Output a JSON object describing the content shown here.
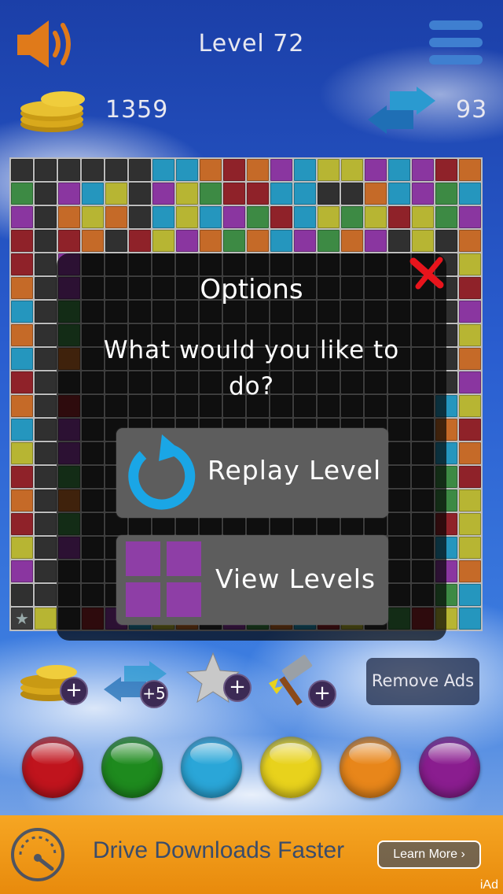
{
  "header": {
    "level_title": "Level 72",
    "coins": "1359",
    "swaps": "93"
  },
  "icons": {
    "speaker": "speaker-icon",
    "menu": "hamburger-menu-icon",
    "coins": "coin-stack-icon",
    "swap": "swap-arrows-icon"
  },
  "board": {
    "colors": {
      "K": "#303030",
      "R": "#8f2229",
      "G": "#3d8a44",
      "B": "#2596be",
      "Y": "#b7b533",
      "O": "#c56a28",
      "P": "#8a36a0",
      "S": "#3c3c3c"
    },
    "rows": [
      "KKKKKKBBOROPBYYPBPRO",
      "GKPBYKPYGRRBBKKOBPGB",
      "PKOYOKBYBPGRBYGYRYGP",
      "RKROKRYPOGOBPGOPKYKO",
      "RKPKKKKKKKKKKKKKKKKY",
      "OKPKKKKKKKKKKKKKKKKR",
      "BKGKKKKKKKKKKKKKKKKP",
      "OKGKKKKKKKKKKKKKKKKY",
      "BKOKKKKKKKKKKKKKKKKO",
      "RKKKKKKKKKKKKKKKKKKP",
      "OKRKKKKKKKKKKKKKKKBY",
      "BKPKKKKKKKKKKKKKKKOR",
      "YKPKKKKKKKKKKKKKKKBO",
      "RKGKKKKKKKKKKKKKKKGR",
      "OKOKKKKKKKKKKKKKKKGY",
      "RKGKKKKKKKKKKKKKKKRY",
      "YKPKKKKKKKKKKKKKKKBY",
      "PKKKKKKKKKKKKKKKKKPO",
      "KKKKKKKKKKKKKKKKKKGB",
      "SYKRPBYOKPGOBRYKGRYB"
    ]
  },
  "modal": {
    "title": "Options",
    "question": "What would you like to do?",
    "replay_label": "Replay Level",
    "levels_label": "View Levels",
    "close_icon": "close-x-icon",
    "replay_icon": "replay-arrow-icon",
    "levels_icon": "level-grid-icon"
  },
  "powerups": {
    "coins_plus": "+",
    "swaps_plus": "+5",
    "star_plus": "+",
    "hammer_plus": "+",
    "remove_ads": "Remove Ads"
  },
  "balls": [
    {
      "name": "red-ball",
      "color": "#c0141d"
    },
    {
      "name": "green-ball",
      "color": "#1e8a1e"
    },
    {
      "name": "blue-ball",
      "color": "#2aa6d8"
    },
    {
      "name": "yellow-ball",
      "color": "#e8d21c"
    },
    {
      "name": "orange-ball",
      "color": "#e8861a"
    },
    {
      "name": "purple-ball",
      "color": "#8a1d8f"
    }
  ],
  "ad": {
    "text": "Drive Downloads Faster",
    "button": "Learn More ›",
    "tag": "iAd",
    "icon": "speedometer-icon"
  }
}
